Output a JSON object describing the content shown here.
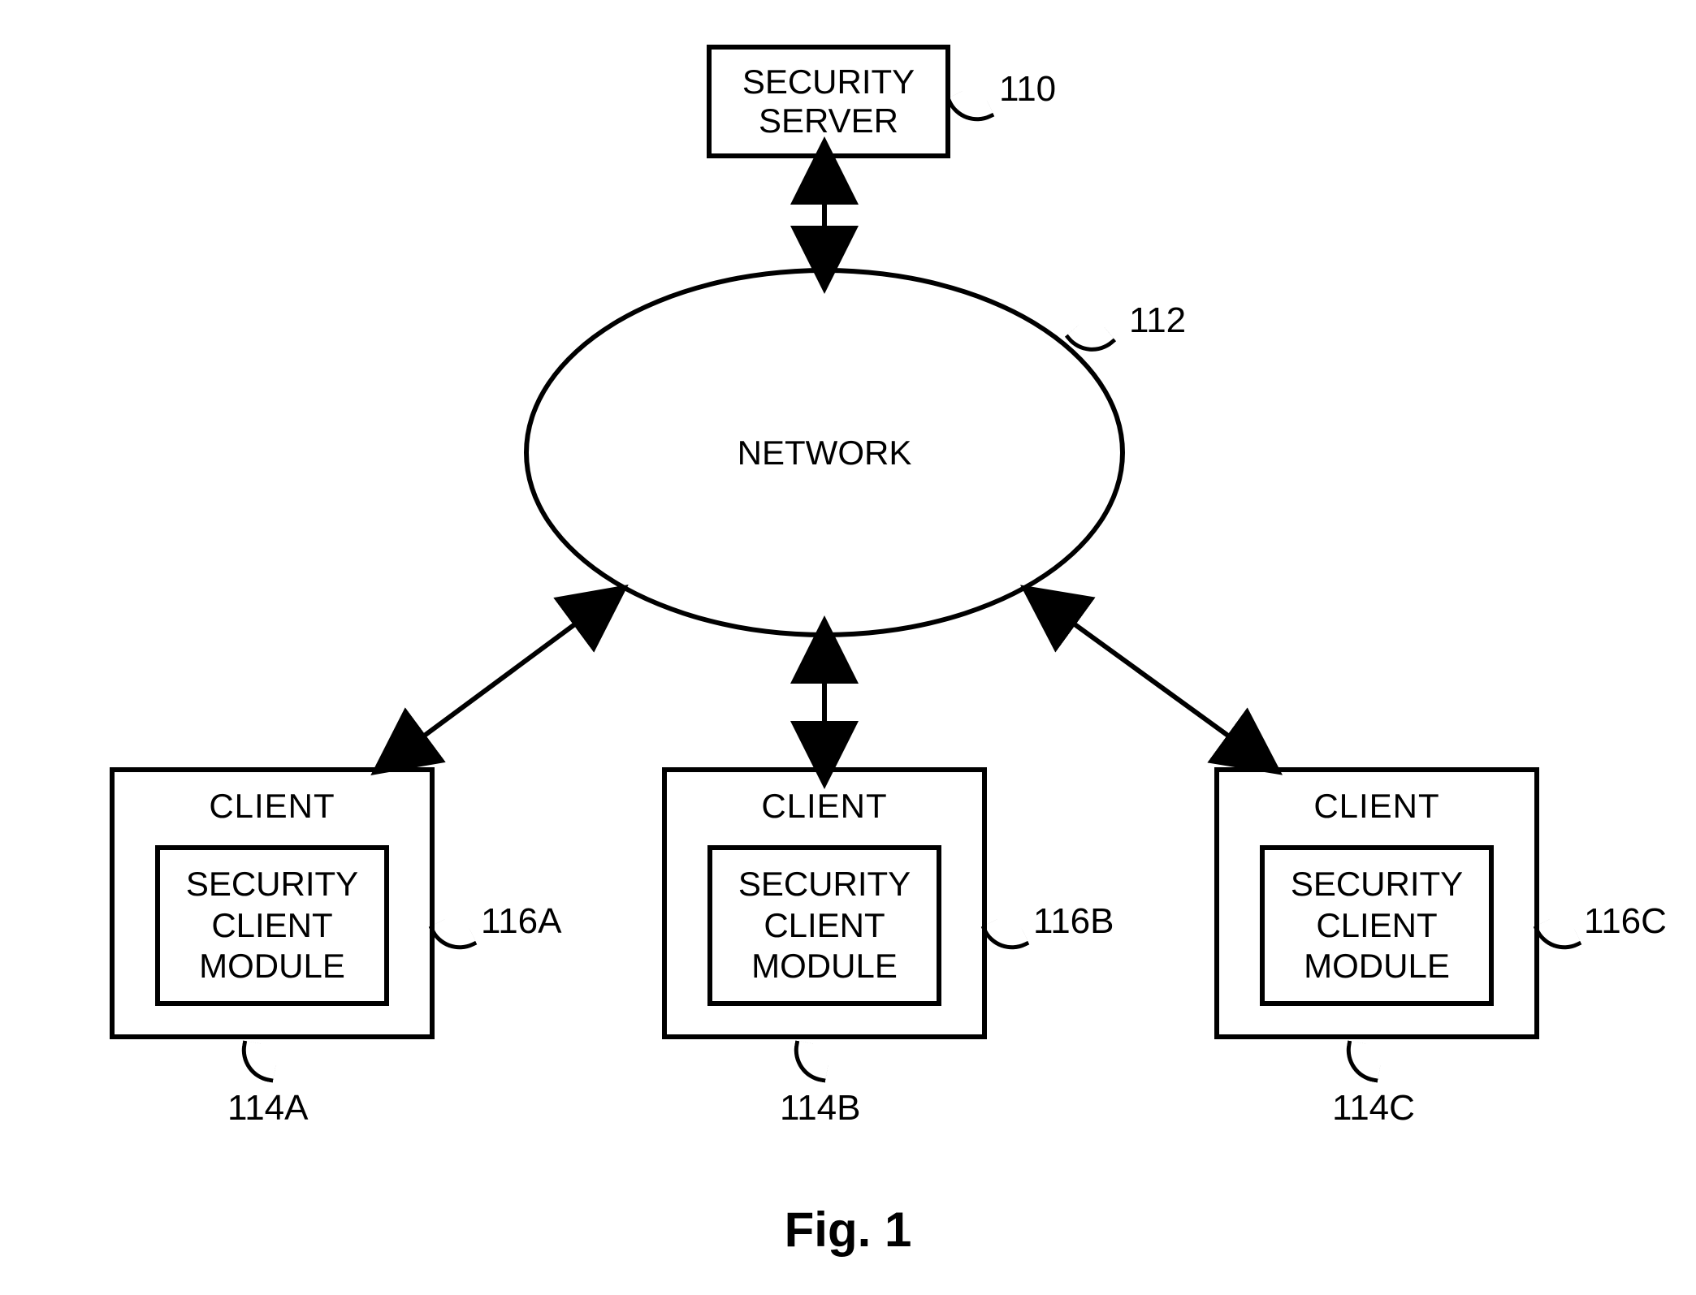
{
  "server": {
    "label": "SECURITY\nSERVER",
    "ref": "110"
  },
  "network": {
    "label": "NETWORK",
    "ref": "112"
  },
  "clients": [
    {
      "title": "CLIENT",
      "module": "SECURITY\nCLIENT\nMODULE",
      "moduleRef": "116A",
      "clientRef": "114A"
    },
    {
      "title": "CLIENT",
      "module": "SECURITY\nCLIENT\nMODULE",
      "moduleRef": "116B",
      "clientRef": "114B"
    },
    {
      "title": "CLIENT",
      "module": "SECURITY\nCLIENT\nMODULE",
      "moduleRef": "116C",
      "clientRef": "114C"
    }
  ],
  "caption": "Fig. 1"
}
